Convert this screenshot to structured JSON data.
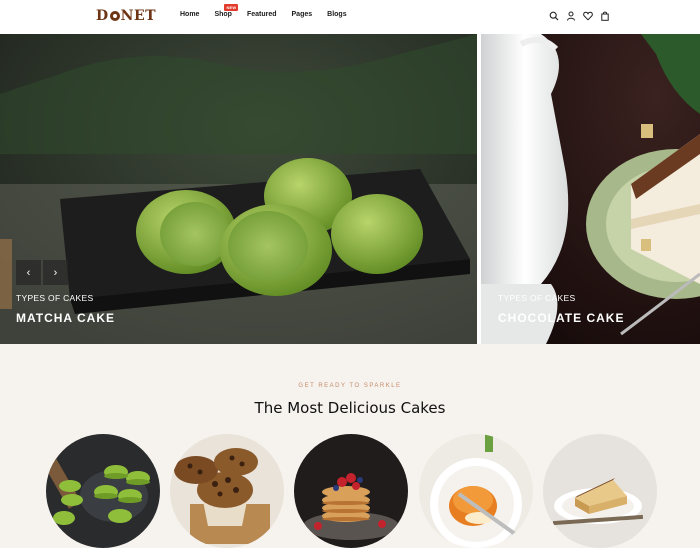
{
  "brand": {
    "logo_text": "DONET"
  },
  "nav": {
    "items": [
      {
        "label": "Home"
      },
      {
        "label": "Shop",
        "badge": "NEW"
      },
      {
        "label": "Featured"
      },
      {
        "label": "Pages"
      },
      {
        "label": "Blogs"
      }
    ]
  },
  "header_icons": [
    "search-icon",
    "user-icon",
    "heart-icon",
    "bag-icon"
  ],
  "hero": {
    "prev_label": "‹",
    "next_label": "›",
    "slides": [
      {
        "subtitle": "Types of cakes",
        "title": "Matcha Cake"
      },
      {
        "subtitle": "Types of cakes",
        "title": "Chocolate Cake"
      }
    ]
  },
  "section": {
    "eyebrow": "Get ready to sparkle",
    "title": "The Most Delicious Cakes"
  },
  "categories": [
    {
      "image": "macarons-photo"
    },
    {
      "image": "muffins-photo"
    },
    {
      "image": "pancakes-photo"
    },
    {
      "image": "flan-photo"
    },
    {
      "image": "cheesecake-photo"
    }
  ],
  "colors": {
    "brand": "#6e3414",
    "badge": "#e23a2c",
    "eyebrow": "#c48a6a",
    "page_bg": "#f6f3ee"
  }
}
